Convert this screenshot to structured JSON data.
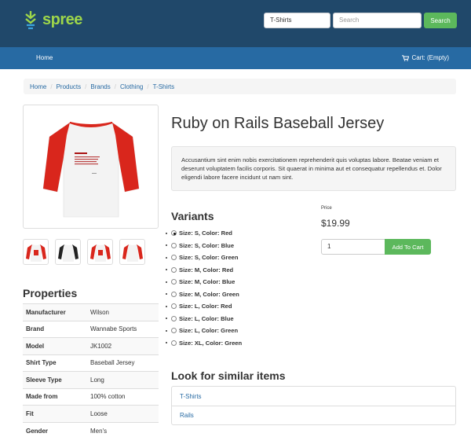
{
  "header": {
    "logo_text": "spree",
    "taxon_select": "T-Shirts",
    "search_placeholder": "Search",
    "search_button": "Search"
  },
  "nav": {
    "home": "Home",
    "cart": "Cart: (Empty)"
  },
  "breadcrumb": [
    "Home",
    "Products",
    "Brands",
    "Clothing",
    "T-Shirts"
  ],
  "product": {
    "title": "Ruby on Rails Baseball Jersey",
    "description": "Accusantium sint enim nobis exercitationem reprehenderit quis voluptas labore. Beatae veniam et deserunt voluptatem facilis corporis. Sit quaerat in minima aut et consequatur repellendus et. Dolor eligendi labore facere incidunt ut nam sint.",
    "price_label": "Price",
    "price": "$19.99",
    "quantity": "1",
    "add_to_cart": "Add To Cart"
  },
  "variants": {
    "title": "Variants",
    "items": [
      {
        "label": "Size: S, Color: Red",
        "selected": true
      },
      {
        "label": "Size: S, Color: Blue",
        "selected": false
      },
      {
        "label": "Size: S, Color: Green",
        "selected": false
      },
      {
        "label": "Size: M, Color: Red",
        "selected": false
      },
      {
        "label": "Size: M, Color: Blue",
        "selected": false
      },
      {
        "label": "Size: M, Color: Green",
        "selected": false
      },
      {
        "label": "Size: L, Color: Red",
        "selected": false
      },
      {
        "label": "Size: L, Color: Blue",
        "selected": false
      },
      {
        "label": "Size: L, Color: Green",
        "selected": false
      },
      {
        "label": "Size: XL, Color: Green",
        "selected": false
      }
    ]
  },
  "properties": {
    "title": "Properties",
    "rows": [
      {
        "key": "Manufacturer",
        "value": "Wilson"
      },
      {
        "key": "Brand",
        "value": "Wannabe Sports"
      },
      {
        "key": "Model",
        "value": "JK1002"
      },
      {
        "key": "Shirt Type",
        "value": "Baseball Jersey"
      },
      {
        "key": "Sleeve Type",
        "value": "Long"
      },
      {
        "key": "Made from",
        "value": "100% cotton"
      },
      {
        "key": "Fit",
        "value": "Loose"
      },
      {
        "key": "Gender",
        "value": "Men's"
      }
    ]
  },
  "similar": {
    "title": "Look for similar items",
    "items": [
      "T-Shirts",
      "Rails"
    ]
  },
  "colors": {
    "header_bg": "#20486a",
    "nav_bg": "#276aa3",
    "brand_green": "#9ed64a",
    "button_green": "#5cb85c",
    "link_blue": "#276aa3",
    "sleeve_red": "#d9261c"
  },
  "thumbnails": [
    {
      "sleeve_color": "#d9261c"
    },
    {
      "sleeve_color": "#222222"
    },
    {
      "sleeve_color": "#d9261c"
    },
    {
      "sleeve_color": "#d9261c"
    }
  ]
}
